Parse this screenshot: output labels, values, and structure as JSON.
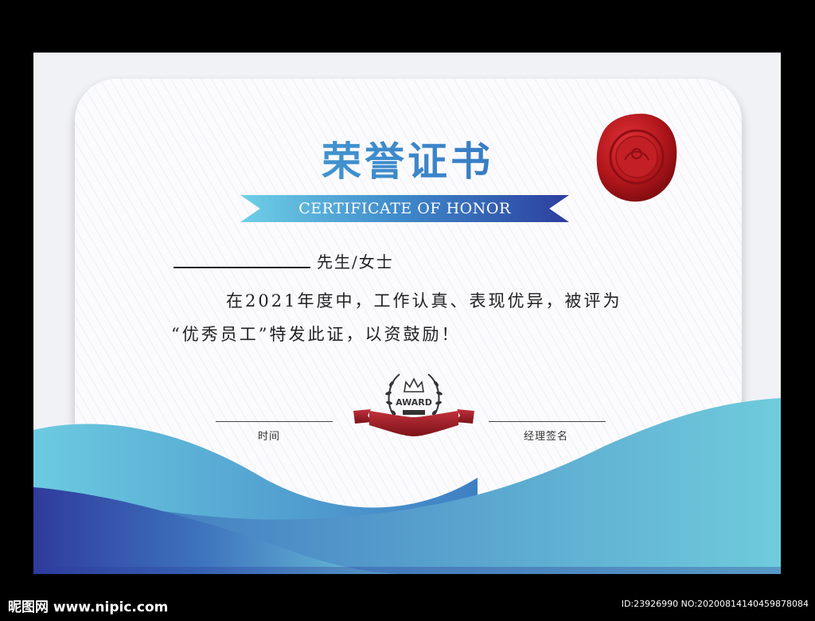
{
  "certificate": {
    "title_cn": "荣誉证书",
    "title_en": "CERTIFICATE OF HONOR",
    "salutation": "先生/女士",
    "body_line1": "在2021年度中，工作认真、表现优异，被评为",
    "body_line2": "“优秀员工”特发此证，以资鼓励！",
    "time_label": "时间",
    "signature_label": "经理签名",
    "award_text": "AWARD"
  },
  "watermark": {
    "site": "昵图网 www.nipic.com",
    "id_text": "ID:23926990 NO:20200814140459878084"
  },
  "colors": {
    "accent_light": "#6fd0e8",
    "accent_dark": "#2c3f9e",
    "seal_red": "#b3171c"
  }
}
